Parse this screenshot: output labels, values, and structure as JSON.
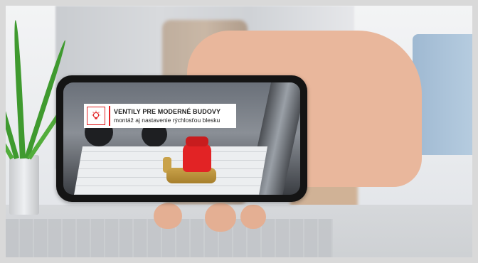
{
  "banner": {
    "title": "VENTILY PRE MODERNÉ BUDOVY",
    "subtitle": "montáž aj nastavenie rýchlosťou blesku",
    "icon": "lightbulb-icon"
  },
  "colors": {
    "brand_red": "#e22325",
    "background": "#d9d9d9"
  }
}
